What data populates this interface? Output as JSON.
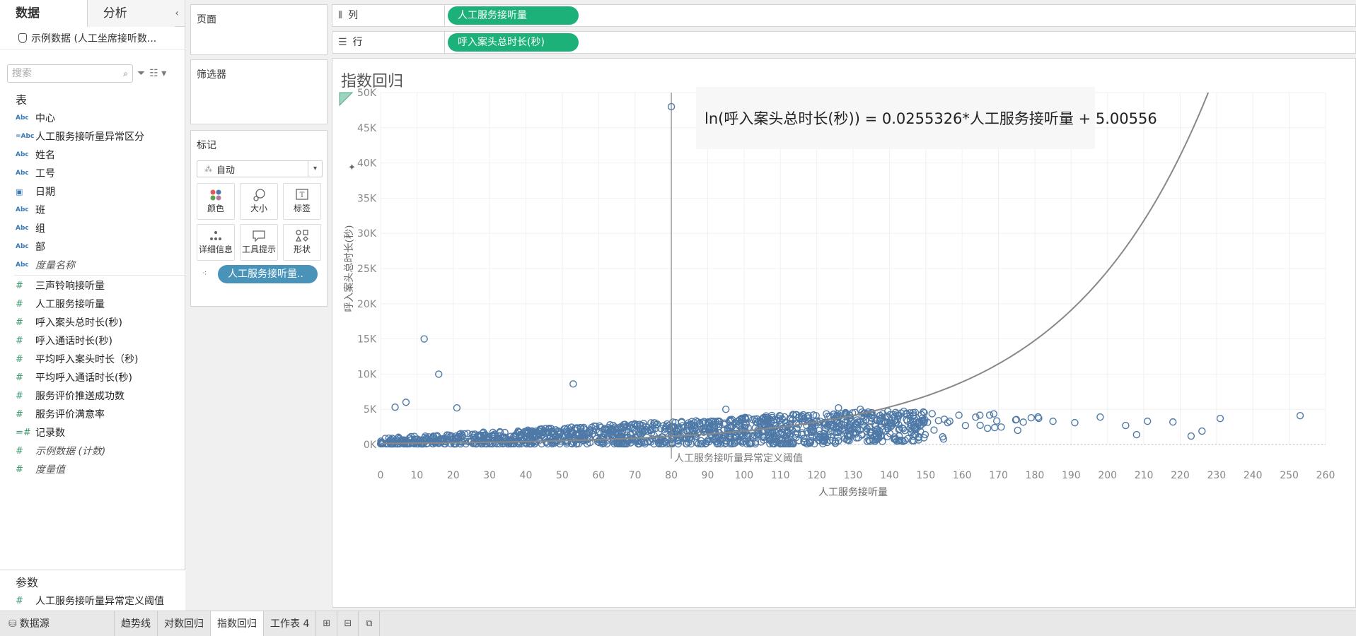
{
  "data_pane": {
    "tabs": [
      "数据",
      "分析"
    ],
    "collapse": "‹",
    "datasource": "示例数据 (人工坐席接听数...",
    "search_placeholder": "搜索",
    "tables_title": "表",
    "fields": [
      {
        "type": "Abc",
        "name": "中心",
        "italic": false
      },
      {
        "type": "=Abc",
        "name": "人工服务接听量异常区分",
        "italic": false
      },
      {
        "type": "Abc",
        "name": "姓名",
        "italic": false
      },
      {
        "type": "Abc",
        "name": "工号",
        "italic": false
      },
      {
        "type": "date",
        "name": "日期",
        "italic": false
      },
      {
        "type": "Abc",
        "name": "班",
        "italic": false
      },
      {
        "type": "Abc",
        "name": "组",
        "italic": false
      },
      {
        "type": "Abc",
        "name": "部",
        "italic": false
      },
      {
        "type": "Abc",
        "name": "度量名称",
        "italic": true
      }
    ],
    "measures": [
      {
        "type": "#",
        "name": "三声铃响接听量",
        "italic": false
      },
      {
        "type": "#",
        "name": "人工服务接听量",
        "italic": false
      },
      {
        "type": "#",
        "name": "呼入案头总时长(秒)",
        "italic": false
      },
      {
        "type": "#",
        "name": "呼入通话时长(秒)",
        "italic": false
      },
      {
        "type": "#",
        "name": "平均呼入案头时长（秒)",
        "italic": false
      },
      {
        "type": "#",
        "name": "平均呼入通话时长(秒)",
        "italic": false
      },
      {
        "type": "#",
        "name": "服务评价推送成功数",
        "italic": false
      },
      {
        "type": "#",
        "name": "服务评价满意率",
        "italic": false
      },
      {
        "type": "=#",
        "name": "记录数",
        "italic": false
      },
      {
        "type": "#",
        "name": "示例数据 (计数)",
        "italic": true
      },
      {
        "type": "#",
        "name": "度量值",
        "italic": true
      }
    ],
    "params_title": "参数",
    "params": [
      {
        "type": "#",
        "name": "人工服务接听量异常定义阈值"
      }
    ]
  },
  "cards": {
    "pages": "页面",
    "filters": "筛选器",
    "marks": "标记",
    "mark_type": "自动",
    "mark_buttons": [
      {
        "icon": "color-icon",
        "label": "颜色"
      },
      {
        "icon": "size-icon",
        "label": "大小"
      },
      {
        "icon": "label-icon",
        "label": "标签"
      },
      {
        "icon": "detail-icon",
        "label": "详细信息"
      },
      {
        "icon": "tooltip-icon",
        "label": "工具提示"
      },
      {
        "icon": "shape-icon",
        "label": "形状"
      }
    ],
    "detail_pill": "人工服务接听量.."
  },
  "shelves": {
    "columns_label": "列",
    "columns_pill": "人工服务接听量",
    "rows_label": "行",
    "rows_pill": "呼入案头总时长(秒)"
  },
  "view": {
    "sheet_title": "指数回归"
  },
  "chart_data": {
    "type": "scatter",
    "title": "指数回归",
    "xlabel": "人工服务接听量",
    "ylabel": "呼入案头总时长(秒)",
    "xlim": [
      0,
      260
    ],
    "ylim": [
      0,
      50000
    ],
    "x_ticks": [
      "0",
      "10",
      "20",
      "30",
      "40",
      "50",
      "60",
      "70",
      "80",
      "90",
      "100",
      "110",
      "120",
      "130",
      "140",
      "150",
      "160",
      "170",
      "180",
      "190",
      "200",
      "210",
      "220",
      "230",
      "240",
      "250",
      "260"
    ],
    "y_ticks": [
      "0K",
      "5K",
      "10K",
      "15K",
      "20K",
      "25K",
      "30K",
      "35K",
      "40K",
      "45K",
      "50K"
    ],
    "grid": true,
    "trend_equation": "ln(呼入案头总时长(秒)) = 0.0255326*人工服务接听量 + 5.00556",
    "trend": {
      "model": "exponential",
      "slope": 0.0255326,
      "intercept": 5.00556
    },
    "reference_line": {
      "x": 80,
      "label": "人工服务接听量异常定义阈值"
    },
    "marker_color": "#4e79a7",
    "outliers": [
      {
        "x": 80,
        "y": 48000
      },
      {
        "x": 12,
        "y": 15000
      },
      {
        "x": 16,
        "y": 10000
      },
      {
        "x": 53,
        "y": 8600
      },
      {
        "x": 7,
        "y": 6000
      },
      {
        "x": 4,
        "y": 5300
      },
      {
        "x": 21,
        "y": 5200
      },
      {
        "x": 95,
        "y": 5000
      },
      {
        "x": 126,
        "y": 5200
      },
      {
        "x": 132,
        "y": 5000
      },
      {
        "x": 253,
        "y": 4100
      },
      {
        "x": 231,
        "y": 3700
      },
      {
        "x": 218,
        "y": 3200
      },
      {
        "x": 211,
        "y": 3300
      },
      {
        "x": 198,
        "y": 3900
      },
      {
        "x": 223,
        "y": 1200
      },
      {
        "x": 226,
        "y": 1900
      },
      {
        "x": 205,
        "y": 2700
      },
      {
        "x": 208,
        "y": 1400
      },
      {
        "x": 191,
        "y": 3100
      },
      {
        "x": 185,
        "y": 3300
      },
      {
        "x": 179,
        "y": 3800
      }
    ]
  },
  "sheet_tabs": {
    "datasource": "数据源",
    "sheets": [
      "趋势线",
      "对数回归",
      "指数回归",
      "工作表 4"
    ],
    "active": "指数回归"
  }
}
